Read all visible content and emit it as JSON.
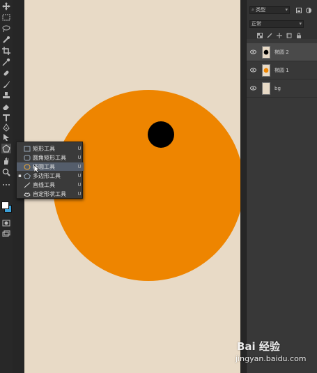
{
  "toolbar": {
    "tools": [
      "move-tool",
      "marquee-tool",
      "lasso-tool",
      "quick-selection-tool",
      "crop-tool",
      "eyedropper-tool",
      "healing-brush-tool",
      "brush-tool",
      "clone-stamp-tool",
      "eraser-tool",
      "gradient-tool",
      "dodge-tool",
      "pen-tool",
      "type-tool",
      "path-selection-tool",
      "shape-tool",
      "hand-tool",
      "zoom-tool",
      "more-tools"
    ],
    "foreground_color": "#ffffff",
    "background_color": "#3aa0d8"
  },
  "canvas": {
    "background_color": "#e8dac6",
    "circle_color": "#ee8500",
    "dot_color": "#000000"
  },
  "shape_flyout": {
    "items": [
      {
        "label": "矩形工具",
        "shortcut": "U",
        "icon": "rectangle-icon",
        "active": false,
        "highlighted": false
      },
      {
        "label": "圆角矩形工具",
        "shortcut": "U",
        "icon": "rounded-rectangle-icon",
        "active": false,
        "highlighted": false
      },
      {
        "label": "椭圆工具",
        "shortcut": "U",
        "icon": "ellipse-icon",
        "active": false,
        "highlighted": true
      },
      {
        "label": "多边形工具",
        "shortcut": "U",
        "icon": "polygon-icon",
        "active": true,
        "highlighted": false
      },
      {
        "label": "直线工具",
        "shortcut": "U",
        "icon": "line-icon",
        "active": false,
        "highlighted": false
      },
      {
        "label": "自定形状工具",
        "shortcut": "U",
        "icon": "custom-shape-icon",
        "active": false,
        "highlighted": false
      }
    ]
  },
  "layers_panel": {
    "filter_kind": "类型",
    "blend_mode": "正常",
    "layers": [
      {
        "name": "椭圆 2",
        "selected": true,
        "thumbnail": "shape"
      },
      {
        "name": "椭圆 1",
        "selected": false,
        "thumbnail": "shape"
      },
      {
        "name": "bg",
        "selected": false,
        "thumbnail": "fill"
      }
    ]
  },
  "watermark": {
    "brand": "Bai 经验",
    "url": "jingyan.baidu.com"
  }
}
